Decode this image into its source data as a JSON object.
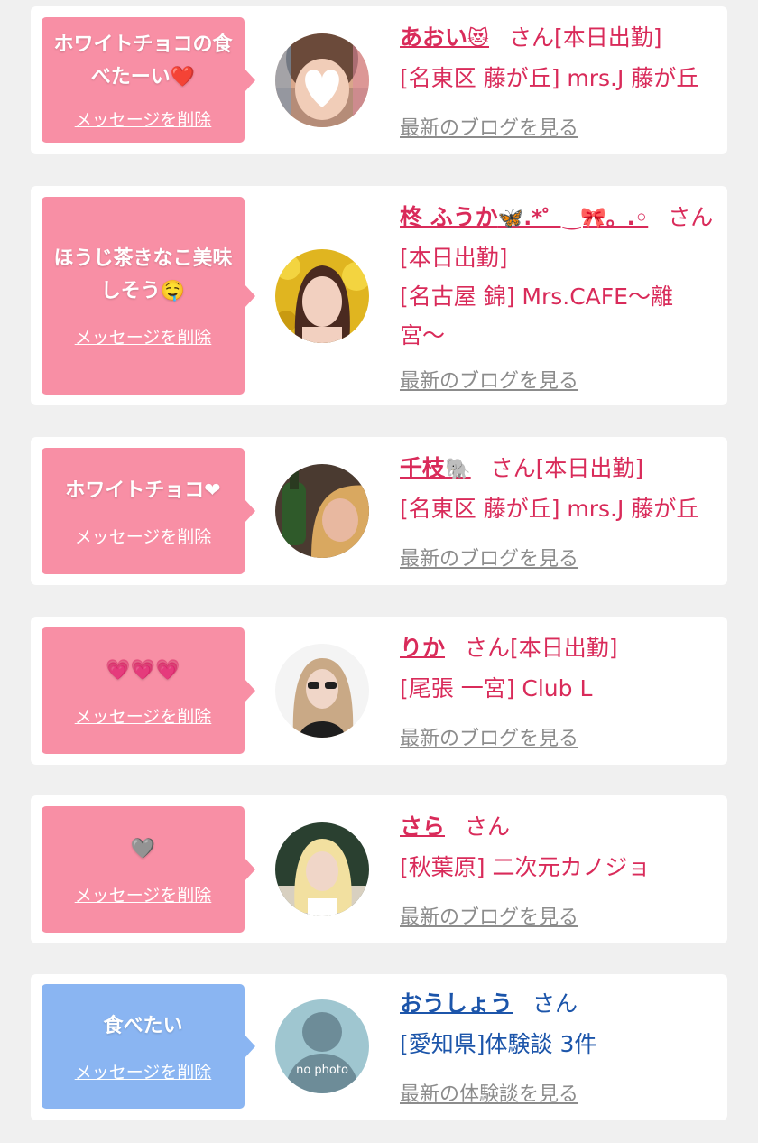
{
  "items": [
    {
      "bubble": "ホワイトチョコの食べたーい❤️",
      "bubble_color": "#f88fa5",
      "delete": "メッセージを削除",
      "name": "あおい",
      "name_emoji": "😻",
      "san": "さん[本日出勤]",
      "shop": "[名東区 藤が丘] mrs.J 藤が丘",
      "link": "最新のブログを見る",
      "avatar": "blurred-face-photo"
    },
    {
      "bubble": "ほうじ茶きなこ美味しそう🤤",
      "bubble_color": "#f88fa5",
      "delete": "メッセージを削除",
      "name": "柊 ふうか",
      "name_emoji": "🦋.*゜‿🎀。.◦",
      "san": "さん[本日出勤]",
      "shop": "[名古屋 錦] Mrs.CAFE〜離宮〜",
      "link": "最新のブログを見る",
      "avatar": "woman-portrait-photo"
    },
    {
      "bubble": "ホワイトチョコ❤",
      "bubble_color": "#f88fa5",
      "delete": "メッセージを削除",
      "name": "千枝",
      "name_emoji": "🐘",
      "san": "さん[本日出勤]",
      "shop": "[名東区 藤が丘] mrs.J 藤が丘",
      "link": "最新のブログを見る",
      "avatar": "woman-with-bottle-photo"
    },
    {
      "bubble": "💗💗💗",
      "bubble_color": "#f88fa5",
      "delete": "メッセージを削除",
      "name": "りか",
      "name_emoji": "",
      "san": "さん[本日出勤]",
      "shop": "[尾張 一宮] Club L",
      "link": "最新のブログを見る",
      "avatar": "woman-sunglasses-photo"
    },
    {
      "bubble": "🩶",
      "bubble_color": "#f88fa5",
      "delete": "メッセージを削除",
      "name": "さら",
      "name_emoji": "",
      "san": "さん",
      "shop": "[秋葉原] 二次元カノジョ",
      "link": "最新のブログを見る",
      "avatar": "blonde-woman-photo"
    },
    {
      "bubble": "食べたい",
      "bubble_color": "#8ab5f2",
      "delete": "メッセージを削除",
      "name": "おうしょう",
      "name_emoji": "",
      "san": "さん",
      "shop": "[愛知県]体験談 3件",
      "link": "最新の体験談を見る",
      "avatar": "no-photo-silhouette",
      "avatar_text": "no photo"
    }
  ]
}
